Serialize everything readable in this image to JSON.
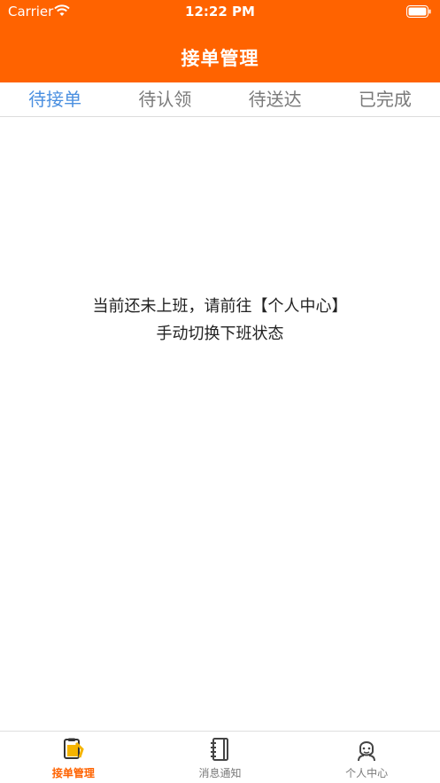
{
  "status_bar": {
    "carrier": "Carrier",
    "time": "12:22 PM"
  },
  "header": {
    "title": "接单管理"
  },
  "tabs": [
    {
      "label": "待接单",
      "active": true
    },
    {
      "label": "待认领",
      "active": false
    },
    {
      "label": "待送达",
      "active": false
    },
    {
      "label": "已完成",
      "active": false
    }
  ],
  "message": {
    "line1": "当前还未上班，请前往【个人中心】",
    "line2": "手动切换下班状态"
  },
  "tabbar": [
    {
      "label": "接单管理",
      "icon": "orders-icon",
      "active": true
    },
    {
      "label": "消息通知",
      "icon": "notebook-icon",
      "active": false
    },
    {
      "label": "个人中心",
      "icon": "person-icon",
      "active": false
    }
  ],
  "colors": {
    "brand": "#ff6300",
    "active_tab": "#4a8fe0"
  }
}
